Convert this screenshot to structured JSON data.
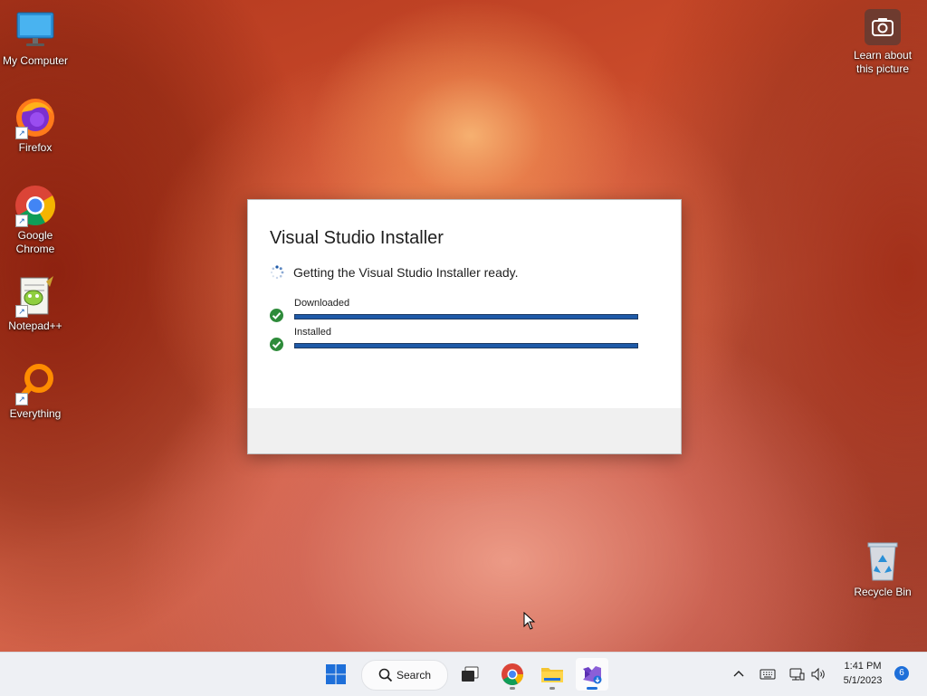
{
  "desktop": {
    "icons": [
      {
        "label": "My Computer"
      },
      {
        "label": "Firefox"
      },
      {
        "label": "Google Chrome"
      },
      {
        "label": "Notepad++"
      },
      {
        "label": "Everything"
      }
    ],
    "learn_about": "Learn about this picture",
    "recycle_bin": "Recycle Bin"
  },
  "dialog": {
    "title": "Visual Studio Installer",
    "status": "Getting the Visual Studio Installer ready.",
    "steps": [
      {
        "label": "Downloaded",
        "progress": 1.0
      },
      {
        "label": "Installed",
        "progress": 1.0
      }
    ]
  },
  "taskbar": {
    "search_label": "Search",
    "time": "1:41 PM",
    "date": "5/1/2023",
    "notification_count": "6"
  },
  "colors": {
    "accent": "#1e5aa8",
    "success": "#2e8b3a"
  }
}
